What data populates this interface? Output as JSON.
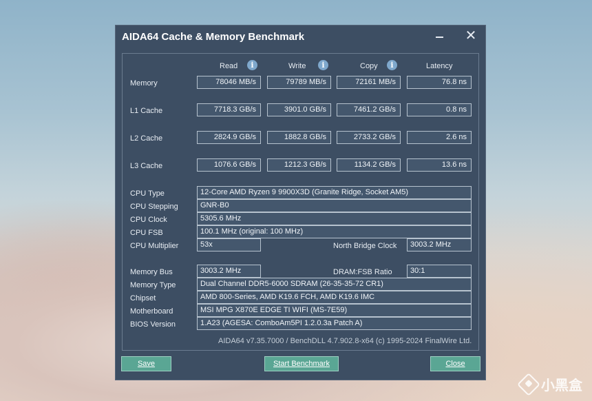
{
  "window": {
    "title": "AIDA64 Cache & Memory Benchmark"
  },
  "columns": [
    "Read",
    "Write",
    "Copy",
    "Latency"
  ],
  "rows": [
    {
      "label": "Memory",
      "read": "78046 MB/s",
      "write": "79789 MB/s",
      "copy": "72161 MB/s",
      "latency": "76.8 ns"
    },
    {
      "label": "L1 Cache",
      "read": "7718.3 GB/s",
      "write": "3901.0 GB/s",
      "copy": "7461.2 GB/s",
      "latency": "0.8 ns"
    },
    {
      "label": "L2 Cache",
      "read": "2824.9 GB/s",
      "write": "1882.8 GB/s",
      "copy": "2733.2 GB/s",
      "latency": "2.6 ns"
    },
    {
      "label": "L3 Cache",
      "read": "1076.6 GB/s",
      "write": "1212.3 GB/s",
      "copy": "1134.2 GB/s",
      "latency": "13.6 ns"
    }
  ],
  "cpu": {
    "type_label": "CPU Type",
    "type": "12-Core AMD Ryzen 9 9900X3D  (Granite Ridge, Socket AM5)",
    "stepping_label": "CPU Stepping",
    "stepping": "GNR-B0",
    "clock_label": "CPU Clock",
    "clock": "5305.6 MHz",
    "fsb_label": "CPU FSB",
    "fsb": "100.1 MHz  (original: 100 MHz)",
    "multiplier_label": "CPU Multiplier",
    "multiplier": "53x",
    "nb_clock_label": "North Bridge Clock",
    "nb_clock": "3003.2 MHz"
  },
  "memory": {
    "bus_label": "Memory Bus",
    "bus": "3003.2 MHz",
    "ratio_label": "DRAM:FSB Ratio",
    "ratio": "30:1",
    "type_label": "Memory Type",
    "type": "Dual Channel DDR5-6000 SDRAM  (26-35-35-72 CR1)",
    "chipset_label": "Chipset",
    "chipset": "AMD 800-Series, AMD K19.6 FCH, AMD K19.6 IMC",
    "motherboard_label": "Motherboard",
    "motherboard": "MSI MPG X870E EDGE TI WIFI (MS-7E59)",
    "bios_label": "BIOS Version",
    "bios": "1.A23  (AGESA: ComboAm5PI 1.2.0.3a Patch A)"
  },
  "footer": "AIDA64 v7.35.7000 / BenchDLL 4.7.902.8-x64  (c) 1995-2024 FinalWire Ltd.",
  "buttons": {
    "save": "Save",
    "start": "Start Benchmark",
    "close": "Close"
  },
  "watermark": "小黑盒",
  "icons": {
    "info": "info-icon",
    "minimize": "minimize-icon",
    "close": "close-icon"
  },
  "colors": {
    "window_bg": "#3d4e63",
    "button_bg": "#5aa694",
    "info_icon": "#7fa8cc"
  }
}
